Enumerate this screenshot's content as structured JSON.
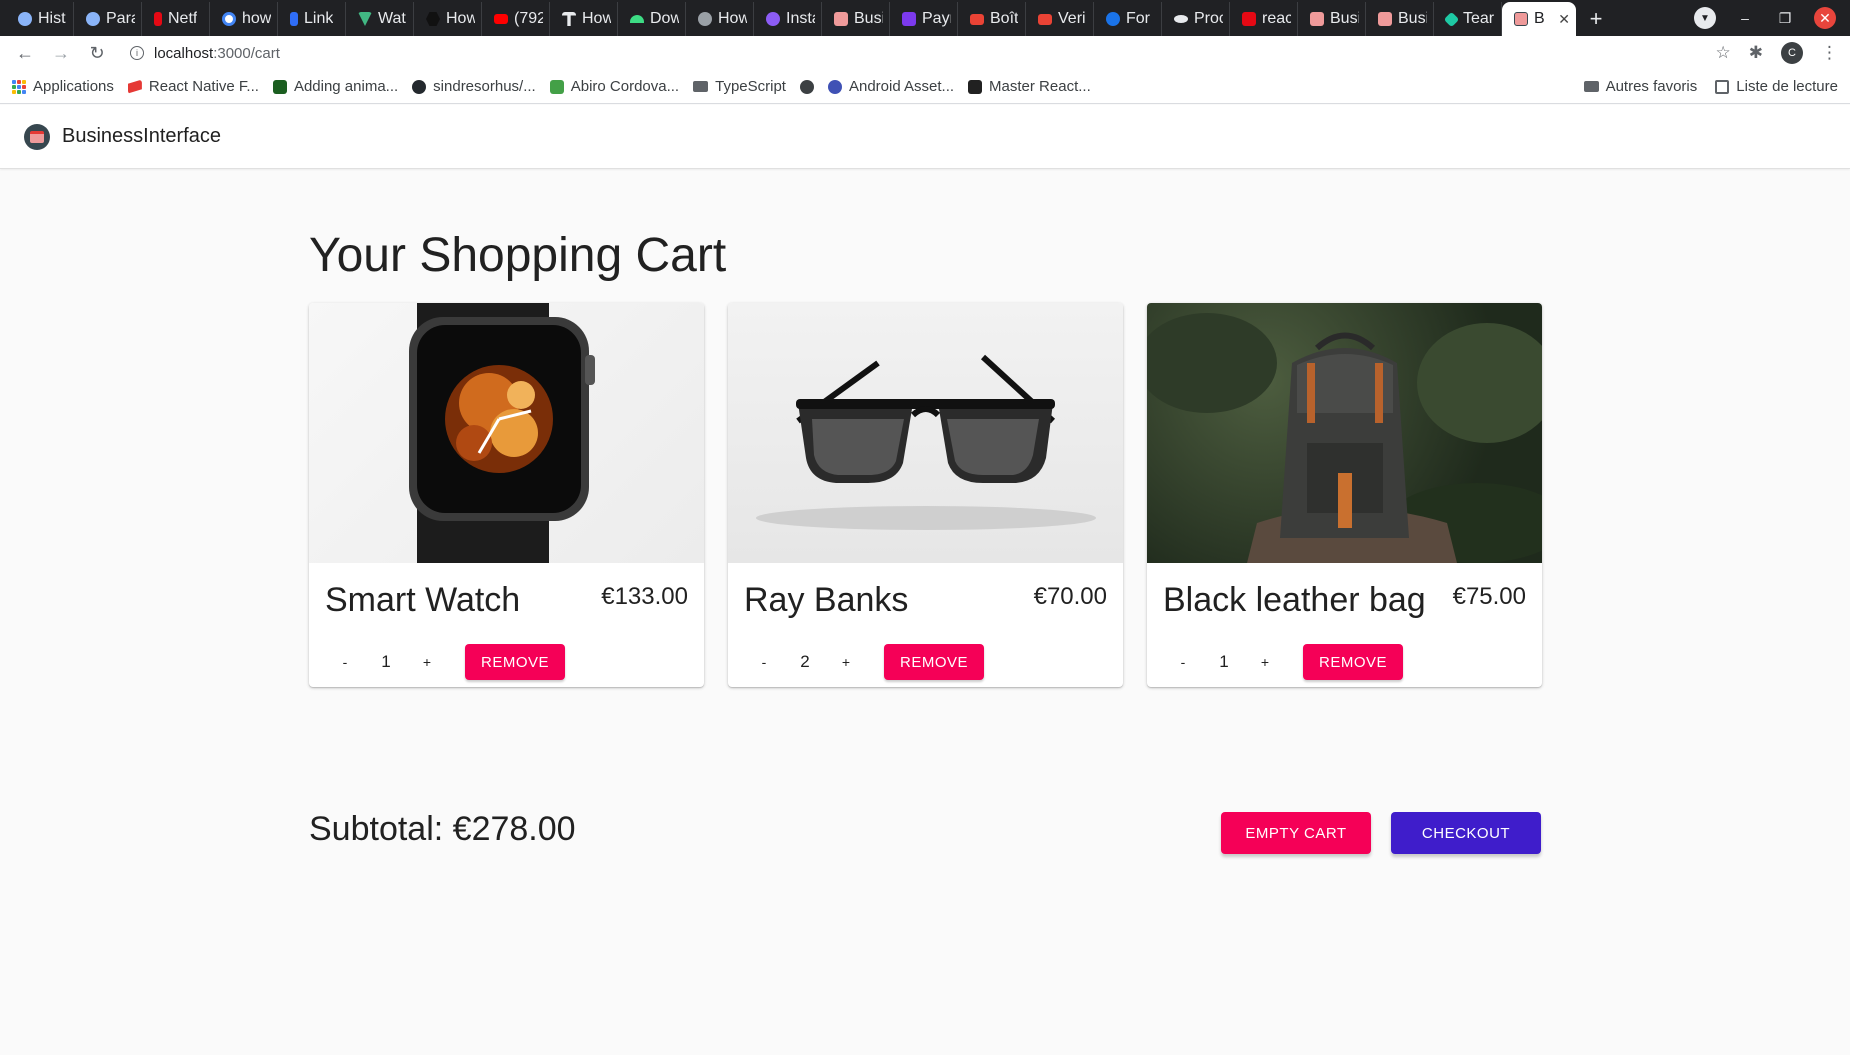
{
  "browser": {
    "tabs": [
      {
        "label": "Hist",
        "icon": "history-icon",
        "color": "#8ab4f8"
      },
      {
        "label": "Para",
        "icon": "settings-icon",
        "color": "#8ab4f8"
      },
      {
        "label": "Netf",
        "icon": "netflix-icon",
        "color": "#e50914"
      },
      {
        "label": "how",
        "icon": "google-icon",
        "color": "#ffffff"
      },
      {
        "label": "Link",
        "icon": "link-icon",
        "color": "#2f6df6"
      },
      {
        "label": "Wat",
        "icon": "vue-icon",
        "color": "#41b883"
      },
      {
        "label": "How",
        "icon": "hex-icon",
        "color": "#222222"
      },
      {
        "label": "(792",
        "icon": "youtube-icon",
        "color": "#ff0000"
      },
      {
        "label": "How",
        "icon": "t-icon",
        "color": "#e8eaed"
      },
      {
        "label": "Dow",
        "icon": "android-icon",
        "color": "#3ddc84"
      },
      {
        "label": "How",
        "icon": "globe-icon",
        "color": "#9aa0a6"
      },
      {
        "label": "Insta",
        "icon": "insta-icon",
        "color": "#8c5cf5"
      },
      {
        "label": "Busi",
        "icon": "shop-icon",
        "color": "#ef9a9a"
      },
      {
        "label": "Payr",
        "icon": "s-icon",
        "color": "#7c3aed"
      },
      {
        "label": "Boît",
        "icon": "gmail-icon",
        "color": "#ea4335"
      },
      {
        "label": "Veri",
        "icon": "gmail-icon",
        "color": "#ea4335"
      },
      {
        "label": "For i",
        "icon": "cloud-icon",
        "color": "#1a73e8"
      },
      {
        "label": "Proc",
        "icon": "cloud-icon",
        "color": "#e8eaed"
      },
      {
        "label": "reac",
        "icon": "n-icon",
        "color": "#e50914"
      },
      {
        "label": "Busi",
        "icon": "shop-icon",
        "color": "#ef9a9a"
      },
      {
        "label": "Busi",
        "icon": "shop-icon",
        "color": "#ef9a9a"
      },
      {
        "label": "Tear",
        "icon": "diamond-icon",
        "color": "#1ec9a4"
      }
    ],
    "active_tab": {
      "label": "B",
      "icon": "shop-icon",
      "close": "✕"
    },
    "new_tab": "+",
    "url_host": "localhost",
    "url_path": ":3000/cart",
    "profile_initial": "C",
    "bookmarks": [
      {
        "label": "Applications",
        "icon": "apps-grid-icon"
      },
      {
        "label": "React Native F...",
        "icon": "react-native-icon",
        "color": "#e53935"
      },
      {
        "label": "Adding anima...",
        "icon": "book-icon",
        "color": "#1b5e20"
      },
      {
        "label": "sindresorhus/...",
        "icon": "github-icon",
        "color": "#24292e"
      },
      {
        "label": "Abiro Cordova...",
        "icon": "grid-icon",
        "color": "#43a047"
      },
      {
        "label": "TypeScript",
        "icon": "folder-icon",
        "color": "#5f6368"
      },
      {
        "label": "",
        "icon": "globe-icon",
        "color": "#3c4043"
      },
      {
        "label": "Android Asset...",
        "icon": "android-asset-icon",
        "color": "#3f51b5"
      },
      {
        "label": "Master React...",
        "icon": "terminal-icon",
        "color": "#212121"
      }
    ],
    "bookmarks_right": [
      {
        "label": "Autres favoris",
        "icon": "folder-icon"
      },
      {
        "label": "Liste de lecture",
        "icon": "reading-list-icon"
      }
    ]
  },
  "app": {
    "brand": "BusinessInterface",
    "title": "Your Shopping Cart",
    "items": [
      {
        "name": "Smart Watch",
        "price": "€133.00",
        "quantity": "1",
        "minus": "-",
        "plus": "+",
        "remove": "REMOVE",
        "image": "smart-watch-image"
      },
      {
        "name": "Ray Banks",
        "price": "€70.00",
        "quantity": "2",
        "minus": "-",
        "plus": "+",
        "remove": "REMOVE",
        "image": "sunglasses-image"
      },
      {
        "name": "Black leather bag",
        "price": "€75.00",
        "quantity": "1",
        "minus": "-",
        "plus": "+",
        "remove": "REMOVE",
        "image": "backpack-image"
      }
    ],
    "subtotal": "Subtotal: €278.00",
    "empty_cart": "EMPTY CART",
    "checkout": "CHECKOUT",
    "colors": {
      "secondary": "#f50057",
      "primary": "#3f1dcb"
    }
  }
}
